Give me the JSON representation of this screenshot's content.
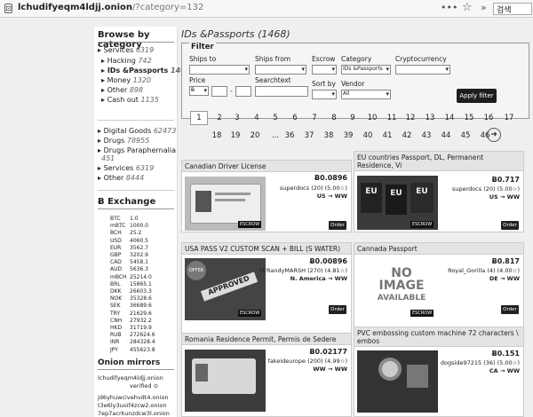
{
  "browser": {
    "url_host": "lchudifyeqm4ldjj.onion",
    "url_path": "/?category=132",
    "more": "•••",
    "search_placeholder": "검색"
  },
  "sidebar": {
    "browse_heading": "Browse by category",
    "categories": [
      {
        "label": "Services",
        "count": "6319"
      },
      {
        "label": "Hacking",
        "count": "742"
      },
      {
        "label": "IDs &Passports",
        "count": "1468"
      },
      {
        "label": "Money",
        "count": "1320"
      },
      {
        "label": "Other",
        "count": "898"
      },
      {
        "label": "Cash out",
        "count": "1135"
      }
    ],
    "categories2": [
      {
        "label": "Digital Goods",
        "count": "62473"
      },
      {
        "label": "Drugs",
        "count": "78955"
      },
      {
        "label": "Drugs Paraphernalia",
        "count": "451"
      },
      {
        "label": "Services",
        "count": "6319"
      },
      {
        "label": "Other",
        "count": "8444"
      }
    ],
    "exchange_heading": "Ƀ Exchange",
    "exchange": [
      {
        "cur": "BTC",
        "val": "1.0"
      },
      {
        "cur": "mBTC",
        "val": "1000.0"
      },
      {
        "cur": "BCH",
        "val": "25.2"
      },
      {
        "cur": "USD",
        "val": "4060.5"
      },
      {
        "cur": "EUR",
        "val": "3562.7"
      },
      {
        "cur": "GBP",
        "val": "3202.9"
      },
      {
        "cur": "CAD",
        "val": "5458.1"
      },
      {
        "cur": "AUD",
        "val": "5636.3"
      },
      {
        "cur": "mBCH",
        "val": "25214.0"
      },
      {
        "cur": "BRL",
        "val": "15865.1"
      },
      {
        "cur": "DKK",
        "val": "26603.3"
      },
      {
        "cur": "NOK",
        "val": "35328.6"
      },
      {
        "cur": "SEK",
        "val": "36689.6"
      },
      {
        "cur": "TRY",
        "val": "21629.6"
      },
      {
        "cur": "CNH",
        "val": "27932.2"
      },
      {
        "cur": "HKD",
        "val": "31719.9"
      },
      {
        "cur": "RUB",
        "val": "272624.6"
      },
      {
        "cur": "INR",
        "val": "284328.4"
      },
      {
        "cur": "JPY",
        "val": "455623.8"
      }
    ],
    "mirrors_heading": "Onion mirrors",
    "mirrors": [
      "lchudifyeqm4ldjj.onion",
      "verified",
      "jd6yhuwcivehvdt4.onion",
      "t3e6ly3uoif4zcw2.onion",
      "7ep7acrkunzdcw3l.onion"
    ]
  },
  "main": {
    "title": "IDs &Passports (1468)",
    "filter": {
      "legend": "Filter",
      "ships_to": "Ships to",
      "ships_from": "Ships from",
      "escrow": "Escrow",
      "category": "Category",
      "category_value": "IDs &Passports",
      "crypto": "Cryptocurrency",
      "price": "Price",
      "price_cur": "Ƀ",
      "price_dash": "-",
      "search": "Searchtext",
      "sort_by": "Sort by",
      "vendor": "Vendor",
      "vendor_value": "All",
      "apply": "Apply filter"
    },
    "pages_row1": [
      "1",
      "2",
      "3",
      "4",
      "5",
      "6",
      "7",
      "8",
      "9",
      "10",
      "11",
      "12",
      "13",
      "14",
      "15",
      "16",
      "17"
    ],
    "pages_row2": [
      "18",
      "19",
      "20",
      "...",
      "36",
      "37",
      "38",
      "39",
      "40",
      "41",
      "42",
      "43",
      "44",
      "45",
      "46"
    ],
    "next_icon": "➔",
    "escrow_badge": "ESCROW",
    "order_label": "Order",
    "listings": [
      {
        "title": "Canadian Driver License",
        "price": "Ƀ0.0896",
        "vendor": "superdocs (20) (5.00☆)",
        "ship": "US → WW"
      },
      {
        "title": "EU countries Passport, DL, Permanent Residence, Vi",
        "price": "Ƀ0.717",
        "vendor": "superdocs (20) (5.00☆)",
        "ship": "US → WW"
      },
      {
        "title": "USA PASS V2 CUSTOM SCAN + BILL (S WATER)",
        "price": "Ƀ0.00896",
        "vendor": "MrRandyMARSH (270) (4.81☆)",
        "ship": "N. America → WW"
      },
      {
        "title": "Cannada Passport",
        "price": "Ƀ0.817",
        "vendor": "Royal_Gorilla (4) (4.00☆)",
        "ship": "DE → WW"
      },
      {
        "title": "Romania Residence Permit, Permis de Sedere",
        "price": "Ƀ0.02177",
        "vendor": "fakeideurope (200) (4.99☆)",
        "ship": "WW → WW"
      },
      {
        "title": "PVC embossing custom machine 72 characters \\ embos",
        "price": "Ƀ0.151",
        "vendor": "dogside97215 (36) (5.00☆)",
        "ship": "CA → WW"
      }
    ],
    "no_image": [
      "NO",
      "IMAGE",
      "AVAILABLE"
    ],
    "stamp_text": "OFFER",
    "approved_text": "APPROVED",
    "eu_text": "EU"
  }
}
